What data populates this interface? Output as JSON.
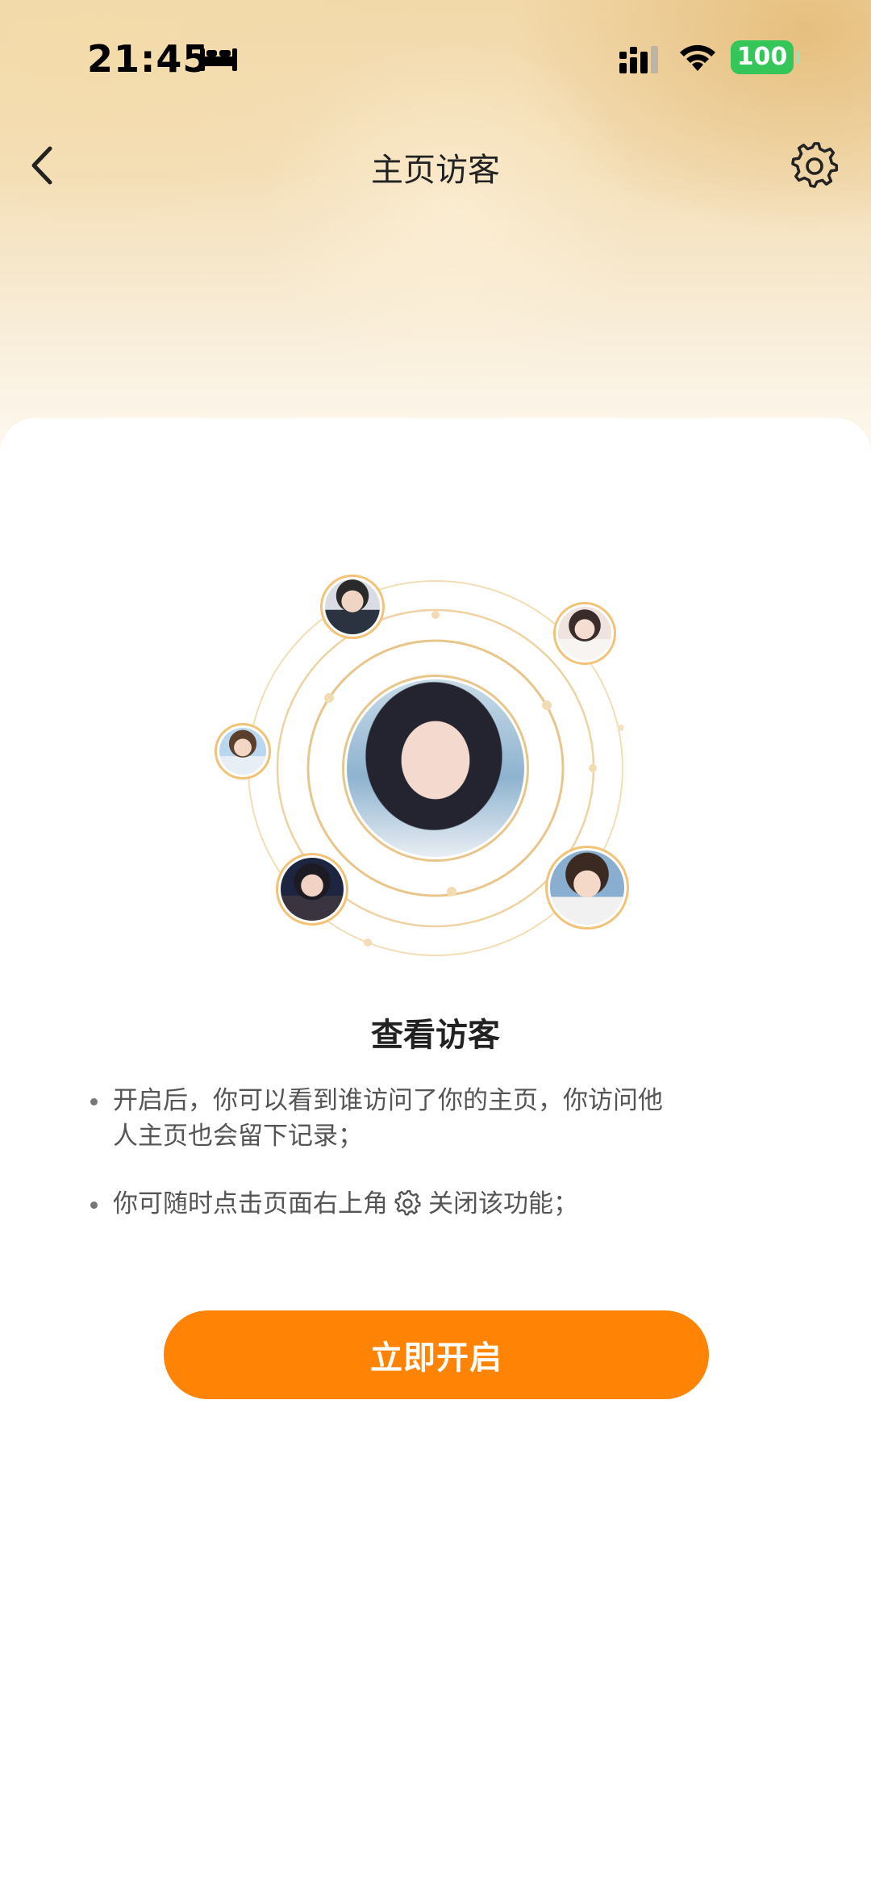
{
  "status_bar": {
    "time": "21:45",
    "battery": "100",
    "icons": [
      "bed-icon",
      "signal-icon",
      "wifi-icon",
      "battery-icon"
    ]
  },
  "nav": {
    "title": "主页访客",
    "back_icon": "chevron-left-icon",
    "settings_icon": "gear-icon"
  },
  "illustration": {
    "center_avatar": "main-user-avatar",
    "visitor_avatars": [
      "visitor-1",
      "visitor-2",
      "visitor-3",
      "visitor-4",
      "visitor-5"
    ]
  },
  "content": {
    "heading": "查看访客",
    "bullet_1": "开启后，你可以看到谁访问了你的主页，你访问他人主页也会留下记录；",
    "bullet_2_before": "你可随时点击页面右上角",
    "bullet_2_after": "关闭该功能；"
  },
  "action": {
    "enable_label": "立即开启"
  },
  "colors": {
    "accent": "#ff8305",
    "ring": "#f2c277",
    "header_gradient": "#f2d9aa"
  }
}
